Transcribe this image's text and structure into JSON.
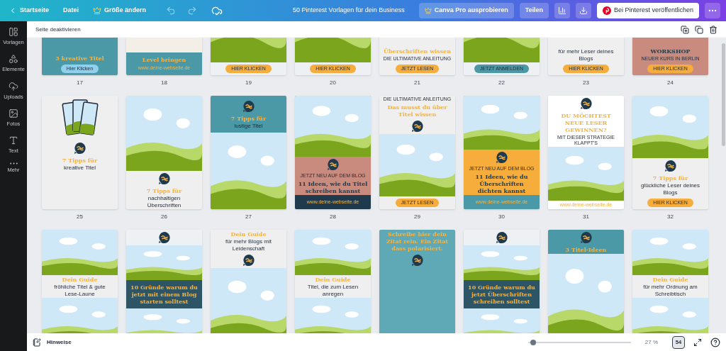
{
  "top_bar": {
    "back": "Startseite",
    "file_menu": "Datei",
    "resize": "Größe ändern",
    "document_title": "50 Pinterest Vorlagen für dein Business",
    "pro_button": "Canva Pro ausprobieren",
    "share_button": "Teilen",
    "publish_button": "Bei Pinterest veröffentlichen"
  },
  "sidebar": {
    "items": [
      {
        "label": "Vorlagen"
      },
      {
        "label": "Elemente"
      },
      {
        "label": "Uploads"
      },
      {
        "label": "Fotos"
      },
      {
        "label": "Text"
      },
      {
        "label": "Mehr"
      }
    ]
  },
  "page_toolbar": {
    "label": "Seite deaktivieren"
  },
  "rows": [
    [
      {
        "number": "17",
        "color": "#4b98a6",
        "items": [
          {
            "kind": "title",
            "text": "3 kreative Titel"
          },
          {
            "kind": "button",
            "text": "Hier Klicken",
            "color": "#8fd0ee"
          }
        ]
      },
      {
        "number": "18",
        "color": "#f4efe6",
        "items": [
          {
            "kind": "block",
            "color": "#4b98a6",
            "items": [
              {
                "kind": "title",
                "text": "Level bringen"
              },
              {
                "kind": "url",
                "text": "www.deine-webseite.de"
              }
            ]
          }
        ]
      },
      {
        "number": "19",
        "color": "#eef1f3",
        "items": [
          {
            "kind": "scene"
          },
          {
            "kind": "button",
            "text": "HIER KLICKEN",
            "color": "#f6ad3b"
          }
        ]
      },
      {
        "number": "20",
        "color": "#eef1f3",
        "items": [
          {
            "kind": "scene"
          },
          {
            "kind": "button",
            "text": "HIER KLICKEN",
            "color": "#f6ad3b"
          }
        ]
      },
      {
        "number": "21",
        "color": "#f0eff0",
        "items": [
          {
            "kind": "title",
            "text": "Überschriften wissen"
          },
          {
            "kind": "caption",
            "text": "DIE ULTIMATIVE ANLEITUNG"
          },
          {
            "kind": "button",
            "text": "JETZT LESEN",
            "color": "#f6ad3b"
          }
        ]
      },
      {
        "number": "22",
        "color": "#eef1f3",
        "items": [
          {
            "kind": "scene"
          },
          {
            "kind": "button",
            "text": "JETZT ANMELDEN",
            "color": "#4b98a6"
          }
        ]
      },
      {
        "number": "23",
        "color": "#f0eff0",
        "items": [
          {
            "kind": "text",
            "text": "für mehr Leser deines Blogs"
          },
          {
            "kind": "button",
            "text": "HIER KLICKEN",
            "color": "#f6ad3b"
          }
        ]
      },
      {
        "number": "24",
        "color": "#c98b7d",
        "items": [
          {
            "kind": "heading",
            "text": "WORKSHOP"
          },
          {
            "kind": "caption",
            "text": "NEUER KURS IN BERLIN"
          },
          {
            "kind": "button",
            "text": "HIER KLICKEN",
            "color": "#f6ad3b"
          }
        ]
      }
    ],
    [
      {
        "number": "25",
        "color": "#f0eff0",
        "items": [
          {
            "kind": "phones"
          },
          {
            "kind": "logo"
          },
          {
            "kind": "title",
            "text": "7 Tipps für"
          },
          {
            "kind": "text",
            "text": "kreative Titel"
          }
        ]
      },
      {
        "number": "26",
        "color": "#f0eff0",
        "items": [
          {
            "kind": "scene"
          },
          {
            "kind": "logo"
          },
          {
            "kind": "title",
            "text": "7 Tipps für"
          },
          {
            "kind": "text",
            "text": "nachhaltigen Überschriften"
          }
        ]
      },
      {
        "number": "27",
        "color": "#eef1f3",
        "items": [
          {
            "kind": "block",
            "color": "#4b98a6",
            "items": [
              {
                "kind": "logo"
              },
              {
                "kind": "title",
                "text": "7 Tipps für"
              },
              {
                "kind": "text",
                "text": "lustige Titel"
              }
            ]
          },
          {
            "kind": "scene"
          }
        ]
      },
      {
        "number": "28",
        "color": "#c98b7d",
        "items": [
          {
            "kind": "scene"
          },
          {
            "kind": "logo"
          },
          {
            "kind": "caption",
            "text": "JETZT NEU AUF DEM BLOG"
          },
          {
            "kind": "heading",
            "text": "11 Ideen, wie du Titel schreiben kannst"
          },
          {
            "kind": "block",
            "color": "#1f3a4d",
            "items": [
              {
                "kind": "url",
                "text": "www.deine-webseite.de"
              }
            ]
          }
        ]
      },
      {
        "number": "29",
        "color": "#f0eff0",
        "items": [
          {
            "kind": "caption",
            "text": "DIE ULTIMATIVE ANLEITUNG"
          },
          {
            "kind": "title",
            "text": "Das musst du über Titel wissen"
          },
          {
            "kind": "logo"
          },
          {
            "kind": "scene"
          },
          {
            "kind": "button",
            "text": "JETZT LESEN",
            "color": "#f6ad3b"
          }
        ]
      },
      {
        "number": "30",
        "color": "#f6ad3b",
        "items": [
          {
            "kind": "scene"
          },
          {
            "kind": "logo"
          },
          {
            "kind": "caption",
            "text": "JETZT NEU AUF DEM BLOG"
          },
          {
            "kind": "heading",
            "text": "11 Ideen, wie du Überschriften dichten kannst"
          },
          {
            "kind": "block",
            "color": "#4b98a6",
            "items": [
              {
                "kind": "url",
                "text": "www.deine-webseite.de"
              }
            ]
          }
        ]
      },
      {
        "number": "31",
        "color": "#ffffff",
        "items": [
          {
            "kind": "logo"
          },
          {
            "kind": "title",
            "text": "DU MÖCHTEST NEUE LESER GEWINNEN?"
          },
          {
            "kind": "caption",
            "text": "MIT DIESER STRATEGIE KLAPPT'S"
          },
          {
            "kind": "scene"
          },
          {
            "kind": "url",
            "text": "www.deine-webseite.de"
          }
        ]
      },
      {
        "number": "32",
        "color": "#f0eff0",
        "items": [
          {
            "kind": "scene"
          },
          {
            "kind": "logo"
          },
          {
            "kind": "title",
            "text": "7 Tipps für"
          },
          {
            "kind": "text",
            "text": "glückliche Leser deines Blogs"
          },
          {
            "kind": "button",
            "text": "HIER KLICKEN",
            "color": "#f6ad3b"
          }
        ]
      }
    ],
    [
      {
        "color": "#f0eff0",
        "items": [
          {
            "kind": "scene"
          },
          {
            "kind": "title",
            "text": "Dein Guide"
          },
          {
            "kind": "text",
            "text": "fröhliche Titel & gute Lese-Laune"
          },
          {
            "kind": "scene"
          }
        ]
      },
      {
        "color": "#eef1f3",
        "items": [
          {
            "kind": "logo"
          },
          {
            "kind": "scene"
          },
          {
            "kind": "block",
            "color": "#2d5566",
            "items": [
              {
                "kind": "title",
                "text": "10 Gründe warum du jetzt mit einem Blog starten solltest"
              }
            ]
          },
          {
            "kind": "scene"
          }
        ]
      },
      {
        "color": "#f0eff0",
        "items": [
          {
            "kind": "title",
            "text": "Dein Guide"
          },
          {
            "kind": "text",
            "text": "für mehr Blogs mit Leidenschaft"
          },
          {
            "kind": "logo"
          },
          {
            "kind": "scene"
          }
        ]
      },
      {
        "color": "#f0eff0",
        "items": [
          {
            "kind": "scene"
          },
          {
            "kind": "title",
            "text": "Dein Guide"
          },
          {
            "kind": "text",
            "text": "Titel, die zum Lesen anregen"
          },
          {
            "kind": "scene"
          }
        ]
      },
      {
        "color": "#5fa8b6",
        "items": [
          {
            "kind": "title",
            "text": "Schreibe hier dein Zitat rein. Ein Zitat dass polarisiert."
          },
          {
            "kind": "logo"
          }
        ]
      },
      {
        "color": "#eef1f3",
        "items": [
          {
            "kind": "logo"
          },
          {
            "kind": "scene"
          },
          {
            "kind": "block",
            "color": "#2d5566",
            "items": [
              {
                "kind": "title",
                "text": "10 Gründe warum du jetzt Überschriften schreiben solltest"
              }
            ]
          },
          {
            "kind": "scene"
          }
        ]
      },
      {
        "color": "#4b98a6",
        "items": [
          {
            "kind": "logo"
          },
          {
            "kind": "title",
            "text": "3 Titel-Ideen"
          },
          {
            "kind": "scene"
          }
        ]
      },
      {
        "color": "#f0eff0",
        "items": [
          {
            "kind": "scene"
          },
          {
            "kind": "title",
            "text": "Dein Guide"
          },
          {
            "kind": "text",
            "text": "für mehr Ordnung am Schreibtisch"
          },
          {
            "kind": "scene"
          }
        ]
      }
    ]
  ],
  "footer": {
    "notes": "Hinweise",
    "zoom": {
      "level": 0.02
    },
    "zoom_reading": "27 %",
    "page_count": "54",
    "grid_view_selected": true
  }
}
